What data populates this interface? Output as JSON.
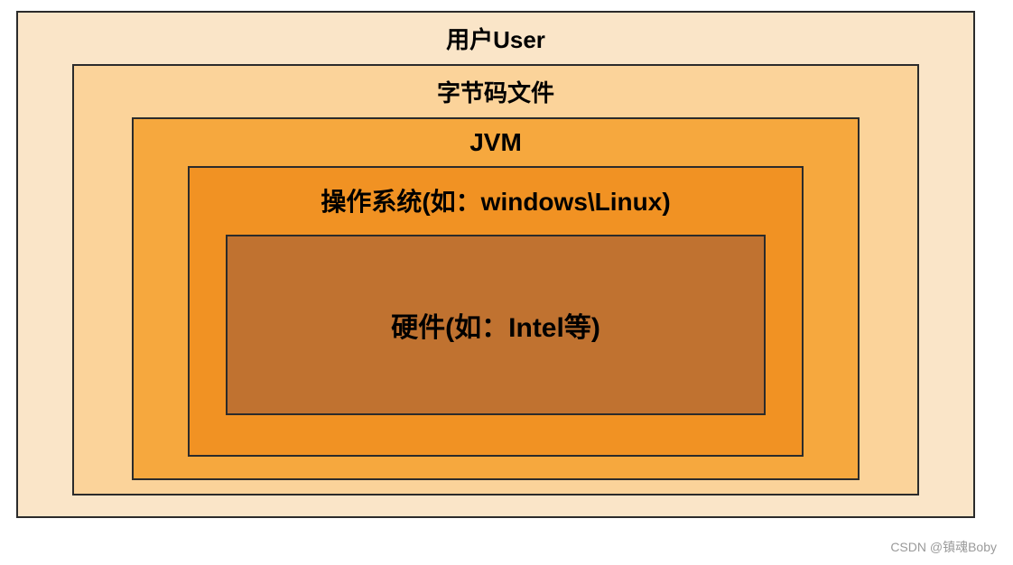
{
  "layers": {
    "user": "用户User",
    "bytecode": "字节码文件",
    "jvm": "JVM",
    "os": "操作系统(如：windows\\Linux)",
    "hardware": "硬件(如：Intel等)"
  },
  "watermark": "CSDN @镇魂Boby"
}
